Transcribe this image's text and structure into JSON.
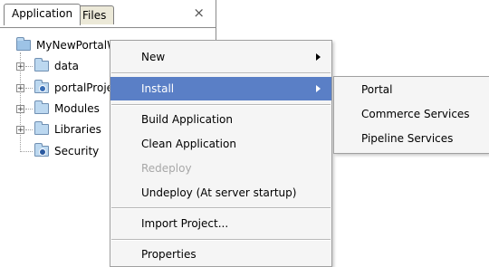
{
  "tabs": [
    {
      "label": "Application",
      "active": true
    },
    {
      "label": "Files",
      "active": false
    }
  ],
  "close_icon": "×",
  "tree": [
    {
      "label": "MyNewPortalWebApplication",
      "icon": "project-folder-icon"
    },
    {
      "label": "data",
      "icon": "folder-icon"
    },
    {
      "label": "portalProject",
      "icon": "portal-folder-icon"
    },
    {
      "label": "Modules",
      "icon": "folder-icon"
    },
    {
      "label": "Libraries",
      "icon": "folder-icon"
    },
    {
      "label": "Security",
      "icon": "security-folder-icon"
    }
  ],
  "menu": {
    "items": [
      {
        "label": "New",
        "submenu": true
      },
      {
        "label": "Install",
        "submenu": true,
        "highlighted": true
      },
      {
        "label": "Build Application"
      },
      {
        "label": "Clean Application"
      },
      {
        "label": "Redeploy",
        "disabled": true
      },
      {
        "label": "Undeploy (At server startup)"
      },
      {
        "label": "Import Project..."
      },
      {
        "label": "Properties"
      }
    ]
  },
  "submenu": {
    "items": [
      {
        "label": "Portal"
      },
      {
        "label": "Commerce Services"
      },
      {
        "label": "Pipeline Services"
      }
    ]
  },
  "colors": {
    "highlight": "#5a7fc6",
    "menu_bg": "#f5f5f5",
    "disabled_text": "#a8a8a8"
  }
}
